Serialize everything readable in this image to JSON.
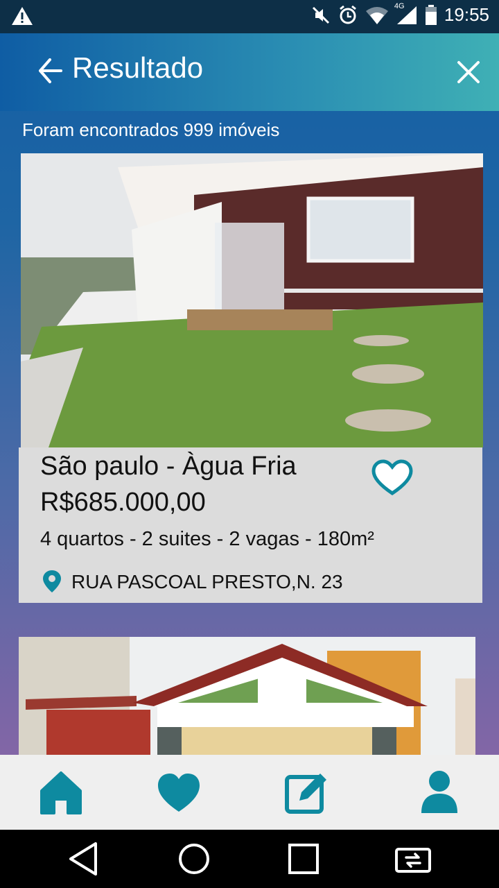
{
  "status_bar": {
    "time": "19:55",
    "network": "4G",
    "icons": [
      "warning-icon",
      "mute-icon",
      "alarm-icon",
      "wifi-icon",
      "signal-icon",
      "battery-icon"
    ]
  },
  "app_bar": {
    "title": "Resultado",
    "back_icon": "arrow-left-icon",
    "close_icon": "close-icon"
  },
  "results": {
    "count_text": "Foram encontrados 999 imóveis"
  },
  "listings": [
    {
      "location": "São paulo - Àgua Fria",
      "price": "R$685.000,00",
      "features": "4 quartos - 2 suites - 2 vagas - 180m²",
      "address": "RUA PASCOAL PRESTO,N. 23",
      "favorite_icon": "heart-outline-icon"
    }
  ],
  "bottom_nav": {
    "items": [
      "home-icon",
      "heart-icon",
      "edit-icon",
      "user-icon"
    ]
  },
  "system_nav": {
    "items": [
      "back-icon",
      "home-circle-icon",
      "recents-icon",
      "rotate-icon"
    ]
  },
  "colors": {
    "accent": "#0e8aa0",
    "status_bar": "#0d2f47",
    "card_info_bg": "#dcdcdc"
  }
}
